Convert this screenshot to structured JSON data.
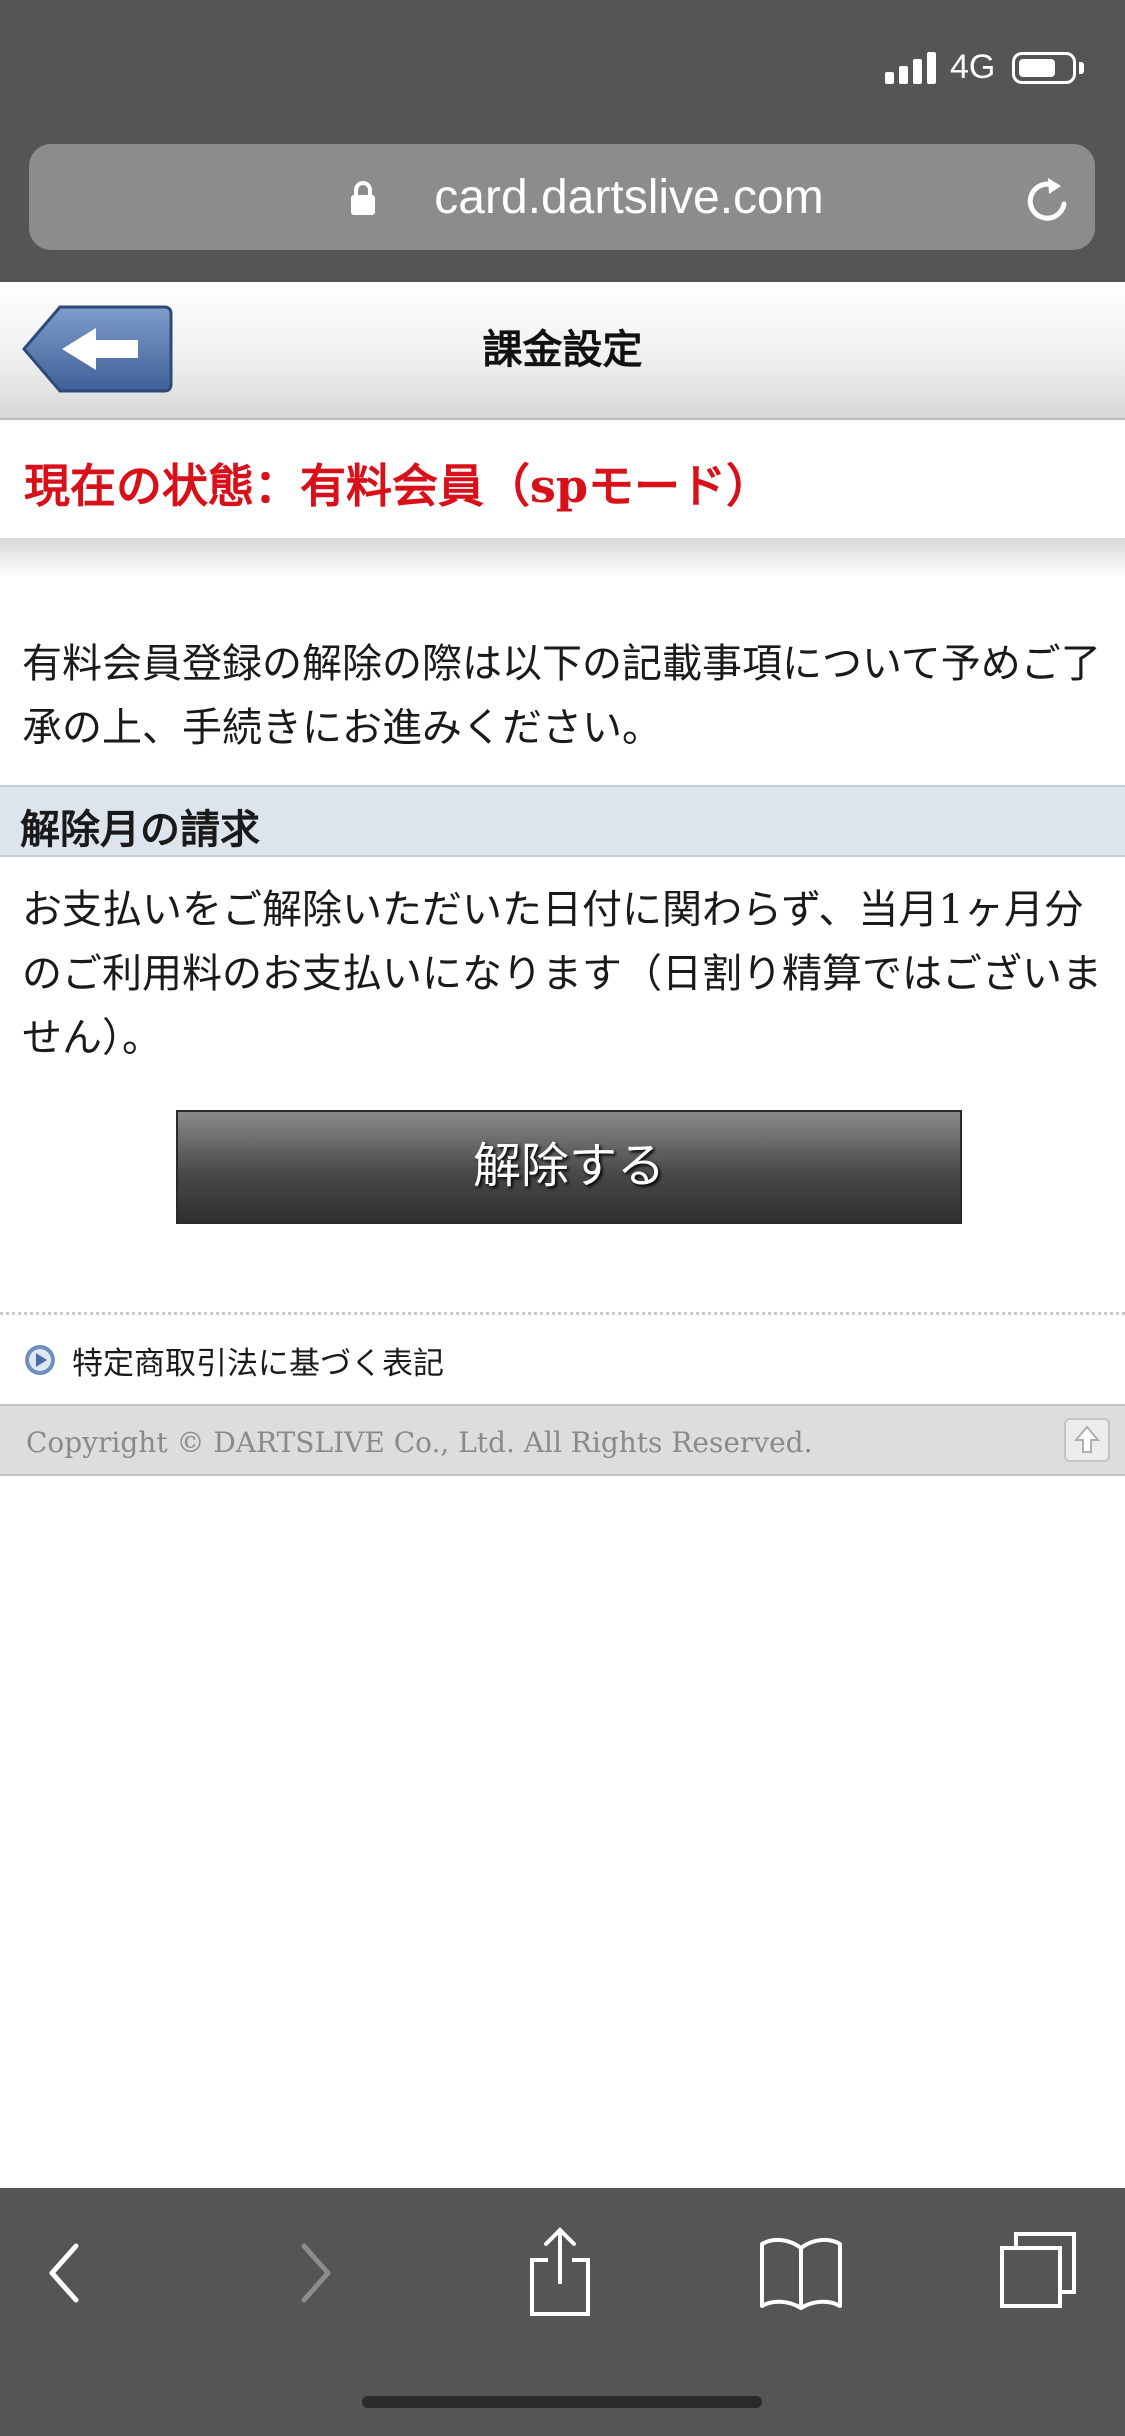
{
  "status_bar": {
    "network": "4G",
    "battery_level": 0.7
  },
  "browser": {
    "url": "card.dartslive.com"
  },
  "header": {
    "title": "課金設定"
  },
  "membership": {
    "status": "現在の状態：有料会員（spモード）"
  },
  "content": {
    "intro": "有料会員登録の解除の際は以下の記載事項について予めご了承の上、手続きにお進みください。",
    "section_title": "解除月の請求",
    "section_body": "お支払いをご解除いただいた日付に関わらず、当月1ヶ月分のご利用料のお支払いになります（日割り精算ではございません）。",
    "cancel_label": "解除する"
  },
  "links": {
    "legal": "特定商取引法に基づく表記"
  },
  "footer": {
    "copyright": "Copyright © DARTSLIVE Co., Ltd. All Rights Reserved."
  },
  "colors": {
    "accent_red": "#d8101a",
    "back_button_blue": "#4a6fa5",
    "section_bg": "#dce4ec",
    "chrome_gray": "#555555"
  },
  "icons": {
    "back": "back-arrow-icon",
    "lock": "lock-icon",
    "reload": "reload-icon",
    "legal": "play-circle-icon",
    "top": "scroll-top-icon",
    "toolbar": [
      "chevron-left-icon",
      "chevron-right-icon",
      "share-icon",
      "bookmarks-icon",
      "tabs-icon"
    ]
  }
}
